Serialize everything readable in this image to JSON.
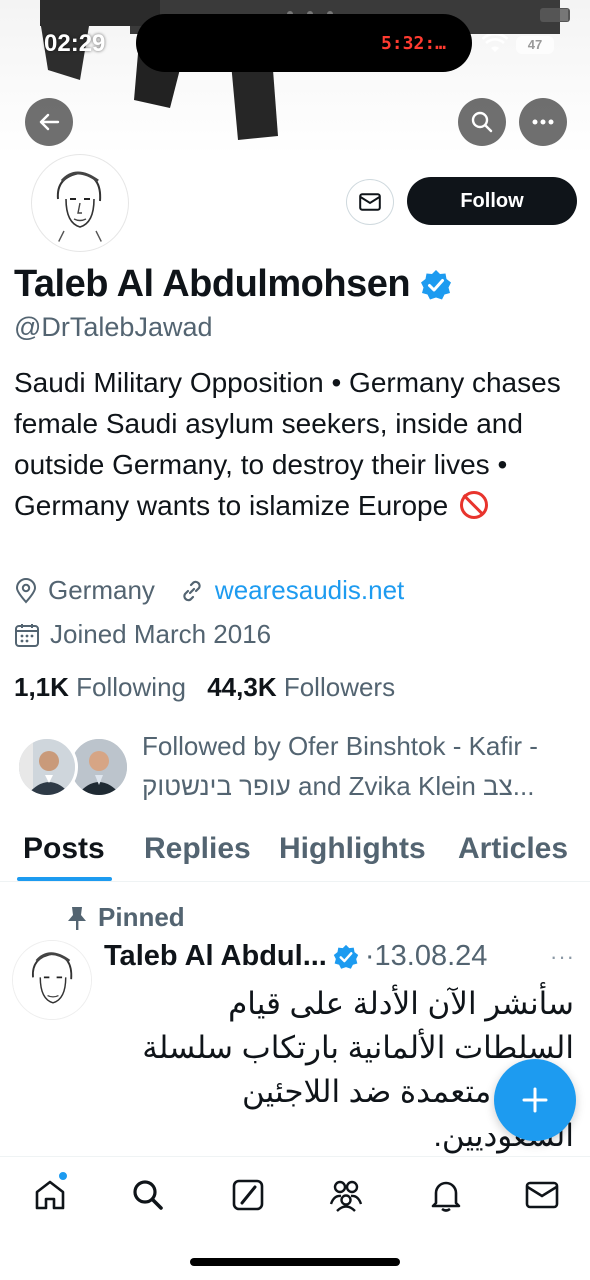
{
  "status_bar": {
    "time": "02:29",
    "timer": "5:32:…",
    "battery": "47"
  },
  "profile": {
    "name": "Taleb Al Abdulmohsen",
    "handle": "@DrTalebJawad",
    "bio": "Saudi Military Opposition • Germany chases female Saudi asylum seekers, inside and outside Germany, to destroy their lives • Germany wants to islamize Europe",
    "location": "Germany",
    "website": "wearesaudis.net",
    "joined": "Joined March 2016",
    "following_count": "1,1K",
    "following_label": "Following",
    "followers_count": "44,3K",
    "followers_label": "Followers",
    "followed_by": "Followed by Ofer Binshtok - Kafir - עופר בינשטוק and Zvika Klein צב..."
  },
  "actions": {
    "follow_label": "Follow"
  },
  "tabs": [
    {
      "label": "Posts",
      "active": true
    },
    {
      "label": "Replies"
    },
    {
      "label": "Highlights"
    },
    {
      "label": "Articles"
    }
  ],
  "tweet": {
    "pinned_label": "Pinned",
    "name": "Taleb Al Abdul...",
    "date": "13.08.24",
    "more": "···",
    "text": "سأنشر الآن الأدلة على قيام السلطات الألمانية بارتكاب سلسلة جرائم متعمدة ضد اللاجئين السعوديين."
  },
  "colors": {
    "accent": "#1d9bf0",
    "text": "#0f1419",
    "muted": "#536471"
  },
  "icons": {
    "nav": [
      "home-icon",
      "search-icon",
      "grok-icon",
      "communities-icon",
      "notifications-icon",
      "messages-icon"
    ]
  }
}
